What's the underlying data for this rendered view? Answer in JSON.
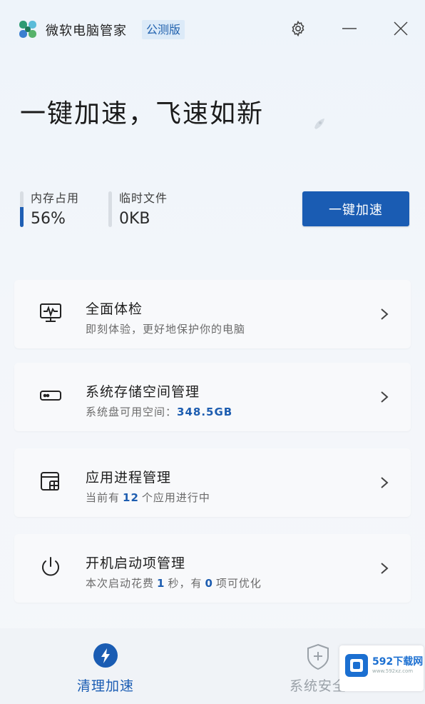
{
  "app": {
    "title": "微软电脑管家",
    "edition_badge": "公测版"
  },
  "hero": {
    "headline": "一键加速，飞速如新"
  },
  "stats": [
    {
      "label": "内存占用",
      "value": "56%",
      "level": 0.56
    },
    {
      "label": "临时文件",
      "value": "0KB",
      "level": 0.0
    }
  ],
  "primary_button": {
    "label": "一键加速"
  },
  "cards": [
    {
      "title": "全面体检",
      "subtitle": "即刻体验，更好地保护你的电脑",
      "icon": "monitor-pulse-icon"
    },
    {
      "title": "系统存储空间管理",
      "sub_prefix": "系统盘可用空间：",
      "sub_value": "348.5GB",
      "icon": "drive-icon"
    },
    {
      "title": "应用进程管理",
      "sub_prefix": "当前有",
      "sub_value": "12",
      "sub_suffix": "个应用进行中",
      "icon": "window-app-icon"
    },
    {
      "title": "开机启动项管理",
      "sub_prefix": "本次启动花费",
      "sub_value": "1",
      "sub_mid": "秒，有",
      "sub_value2": "0",
      "sub_suffix": "项可优化",
      "icon": "power-icon"
    }
  ],
  "bottom_nav": [
    {
      "label": "清理加速",
      "icon": "lightning-icon",
      "active": true
    },
    {
      "label": "系统安全",
      "icon": "shield-plus-icon",
      "active": false
    }
  ],
  "watermark": {
    "text": "592下载网",
    "subtext": "www.592xz.com"
  },
  "colors": {
    "accent": "#1a5cb3",
    "highlight": "#1d5db0",
    "badge_bg": "#dceaf8"
  }
}
